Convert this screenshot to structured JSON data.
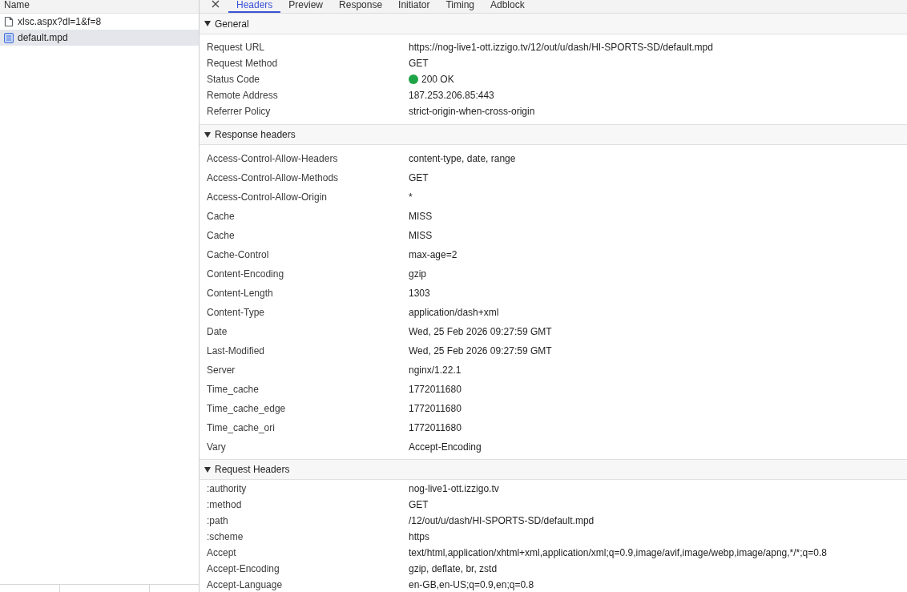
{
  "request_list": {
    "column_header": "Name",
    "items": [
      {
        "name": "xlsc.aspx?dl=1&f=8",
        "kind": "file",
        "selected": false
      },
      {
        "name": "default.mpd",
        "kind": "document",
        "selected": true
      }
    ]
  },
  "detail": {
    "tabs": [
      {
        "label": "Headers",
        "selected": true
      },
      {
        "label": "Preview",
        "selected": false
      },
      {
        "label": "Response",
        "selected": false
      },
      {
        "label": "Initiator",
        "selected": false
      },
      {
        "label": "Timing",
        "selected": false
      },
      {
        "label": "Adblock",
        "selected": false
      }
    ],
    "sections": [
      {
        "title": "General",
        "kind": "general",
        "expanded": true,
        "rows": [
          {
            "name": "Request URL",
            "value": "https://nog-live1-ott.izzigo.tv/12/out/u/dash/HI-SPORTS-SD/default.mpd"
          },
          {
            "name": "Request Method",
            "value": "GET"
          },
          {
            "name": "Status Code",
            "value": "200 OK",
            "color": "#1ea446"
          },
          {
            "name": "Remote Address",
            "value": "187.253.206.85:443"
          },
          {
            "name": "Referrer Policy",
            "value": "strict-origin-when-cross-origin"
          }
        ]
      },
      {
        "title": "Response headers",
        "kind": "response",
        "expanded": true,
        "rows": [
          {
            "name": "Access-Control-Allow-Headers",
            "value": "content-type, date, range"
          },
          {
            "name": "Access-Control-Allow-Methods",
            "value": "GET"
          },
          {
            "name": "Access-Control-Allow-Origin",
            "value": "*"
          },
          {
            "name": "Cache",
            "value": "MISS"
          },
          {
            "name": "Cache",
            "value": "MISS"
          },
          {
            "name": "Cache-Control",
            "value": "max-age=2"
          },
          {
            "name": "Content-Encoding",
            "value": "gzip"
          },
          {
            "name": "Content-Length",
            "value": "1303"
          },
          {
            "name": "Content-Type",
            "value": "application/dash+xml"
          },
          {
            "name": "Date",
            "value": "Wed, 25 Feb 2026 09:27:59 GMT"
          },
          {
            "name": "Last-Modified",
            "value": "Wed, 25 Feb 2026 09:27:59 GMT"
          },
          {
            "name": "Server",
            "value": "nginx/1.22.1"
          },
          {
            "name": "Time_cache",
            "value": "1772011680"
          },
          {
            "name": "Time_cache_edge",
            "value": "1772011680"
          },
          {
            "name": "Time_cache_ori",
            "value": "1772011680"
          },
          {
            "name": "Vary",
            "value": "Accept-Encoding"
          }
        ]
      },
      {
        "title": "Request Headers",
        "kind": "request",
        "expanded": true,
        "rows": [
          {
            "name": ":authority",
            "value": "nog-live1-ott.izzigo.tv"
          },
          {
            "name": ":method",
            "value": "GET"
          },
          {
            "name": ":path",
            "value": "/12/out/u/dash/HI-SPORTS-SD/default.mpd"
          },
          {
            "name": ":scheme",
            "value": "https"
          },
          {
            "name": "Accept",
            "value": "text/html,application/xhtml+xml,application/xml;q=0.9,image/avif,image/webp,image/apng,*/*;q=0.8"
          },
          {
            "name": "Accept-Encoding",
            "value": "gzip, deflate, br, zstd"
          },
          {
            "name": "Accept-Language",
            "value": "en-GB,en-US;q=0.9,en;q=0.8"
          }
        ]
      }
    ]
  }
}
